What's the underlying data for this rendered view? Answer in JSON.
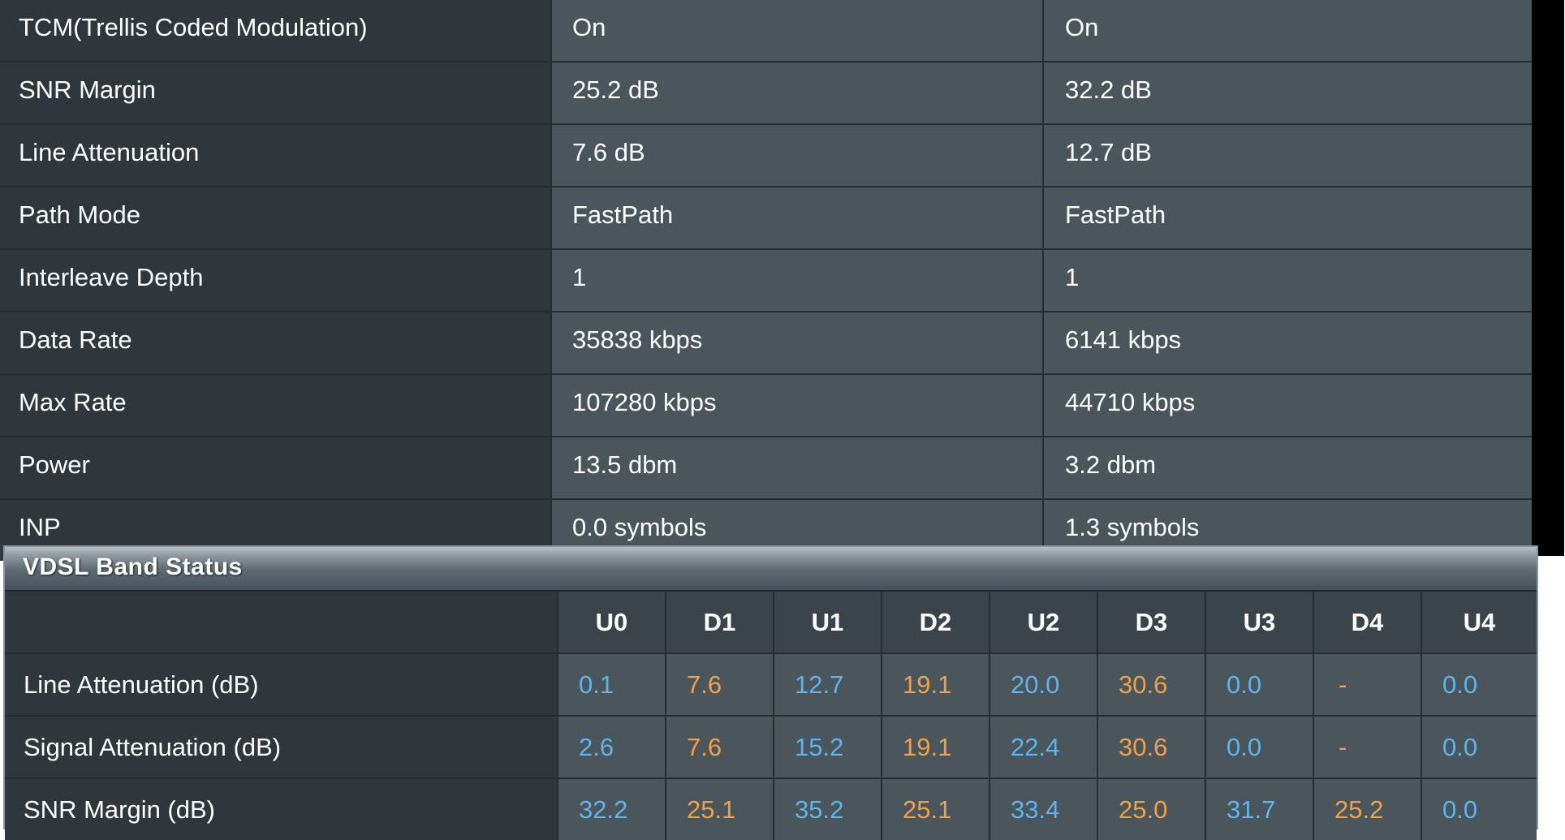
{
  "line_status": {
    "rows": [
      {
        "label": "TCM(Trellis Coded Modulation)",
        "downstream": "On",
        "upstream": "On"
      },
      {
        "label": "SNR Margin",
        "downstream": "25.2 dB",
        "upstream": "32.2 dB"
      },
      {
        "label": "Line Attenuation",
        "downstream": "7.6 dB",
        "upstream": "12.7 dB"
      },
      {
        "label": "Path Mode",
        "downstream": "FastPath",
        "upstream": "FastPath"
      },
      {
        "label": "Interleave Depth",
        "downstream": "1",
        "upstream": "1"
      },
      {
        "label": "Data Rate",
        "downstream": "35838 kbps",
        "upstream": "6141 kbps"
      },
      {
        "label": "Max Rate",
        "downstream": "107280 kbps",
        "upstream": "44710 kbps"
      },
      {
        "label": "Power",
        "downstream": "13.5 dbm",
        "upstream": "3.2 dbm"
      },
      {
        "label": "INP",
        "downstream": "0.0 symbols",
        "upstream": "1.3 symbols"
      }
    ]
  },
  "band_status": {
    "title": "VDSL Band Status",
    "headers": [
      "U0",
      "D1",
      "U1",
      "D2",
      "U2",
      "D3",
      "U3",
      "D4",
      "U4"
    ],
    "rows": [
      {
        "label": "Line Attenuation (dB)",
        "values": [
          "0.1",
          "7.6",
          "12.7",
          "19.1",
          "20.0",
          "30.6",
          "0.0",
          "-",
          "0.0"
        ]
      },
      {
        "label": "Signal Attenuation (dB)",
        "values": [
          "2.6",
          "7.6",
          "15.2",
          "19.1",
          "22.4",
          "30.6",
          "0.0",
          "-",
          "0.0"
        ]
      },
      {
        "label": "SNR Margin (dB)",
        "values": [
          "32.2",
          "25.1",
          "35.2",
          "25.1",
          "33.4",
          "25.0",
          "31.7",
          "25.2",
          "0.0"
        ]
      }
    ]
  },
  "colors": {
    "upstream_band_value": "#5eb4ec",
    "downstream_band_value": "#f0a048",
    "label_cell_bg": "#2f373c",
    "value_cell_bg": "#4a555c",
    "grid_line": "#262d31"
  }
}
